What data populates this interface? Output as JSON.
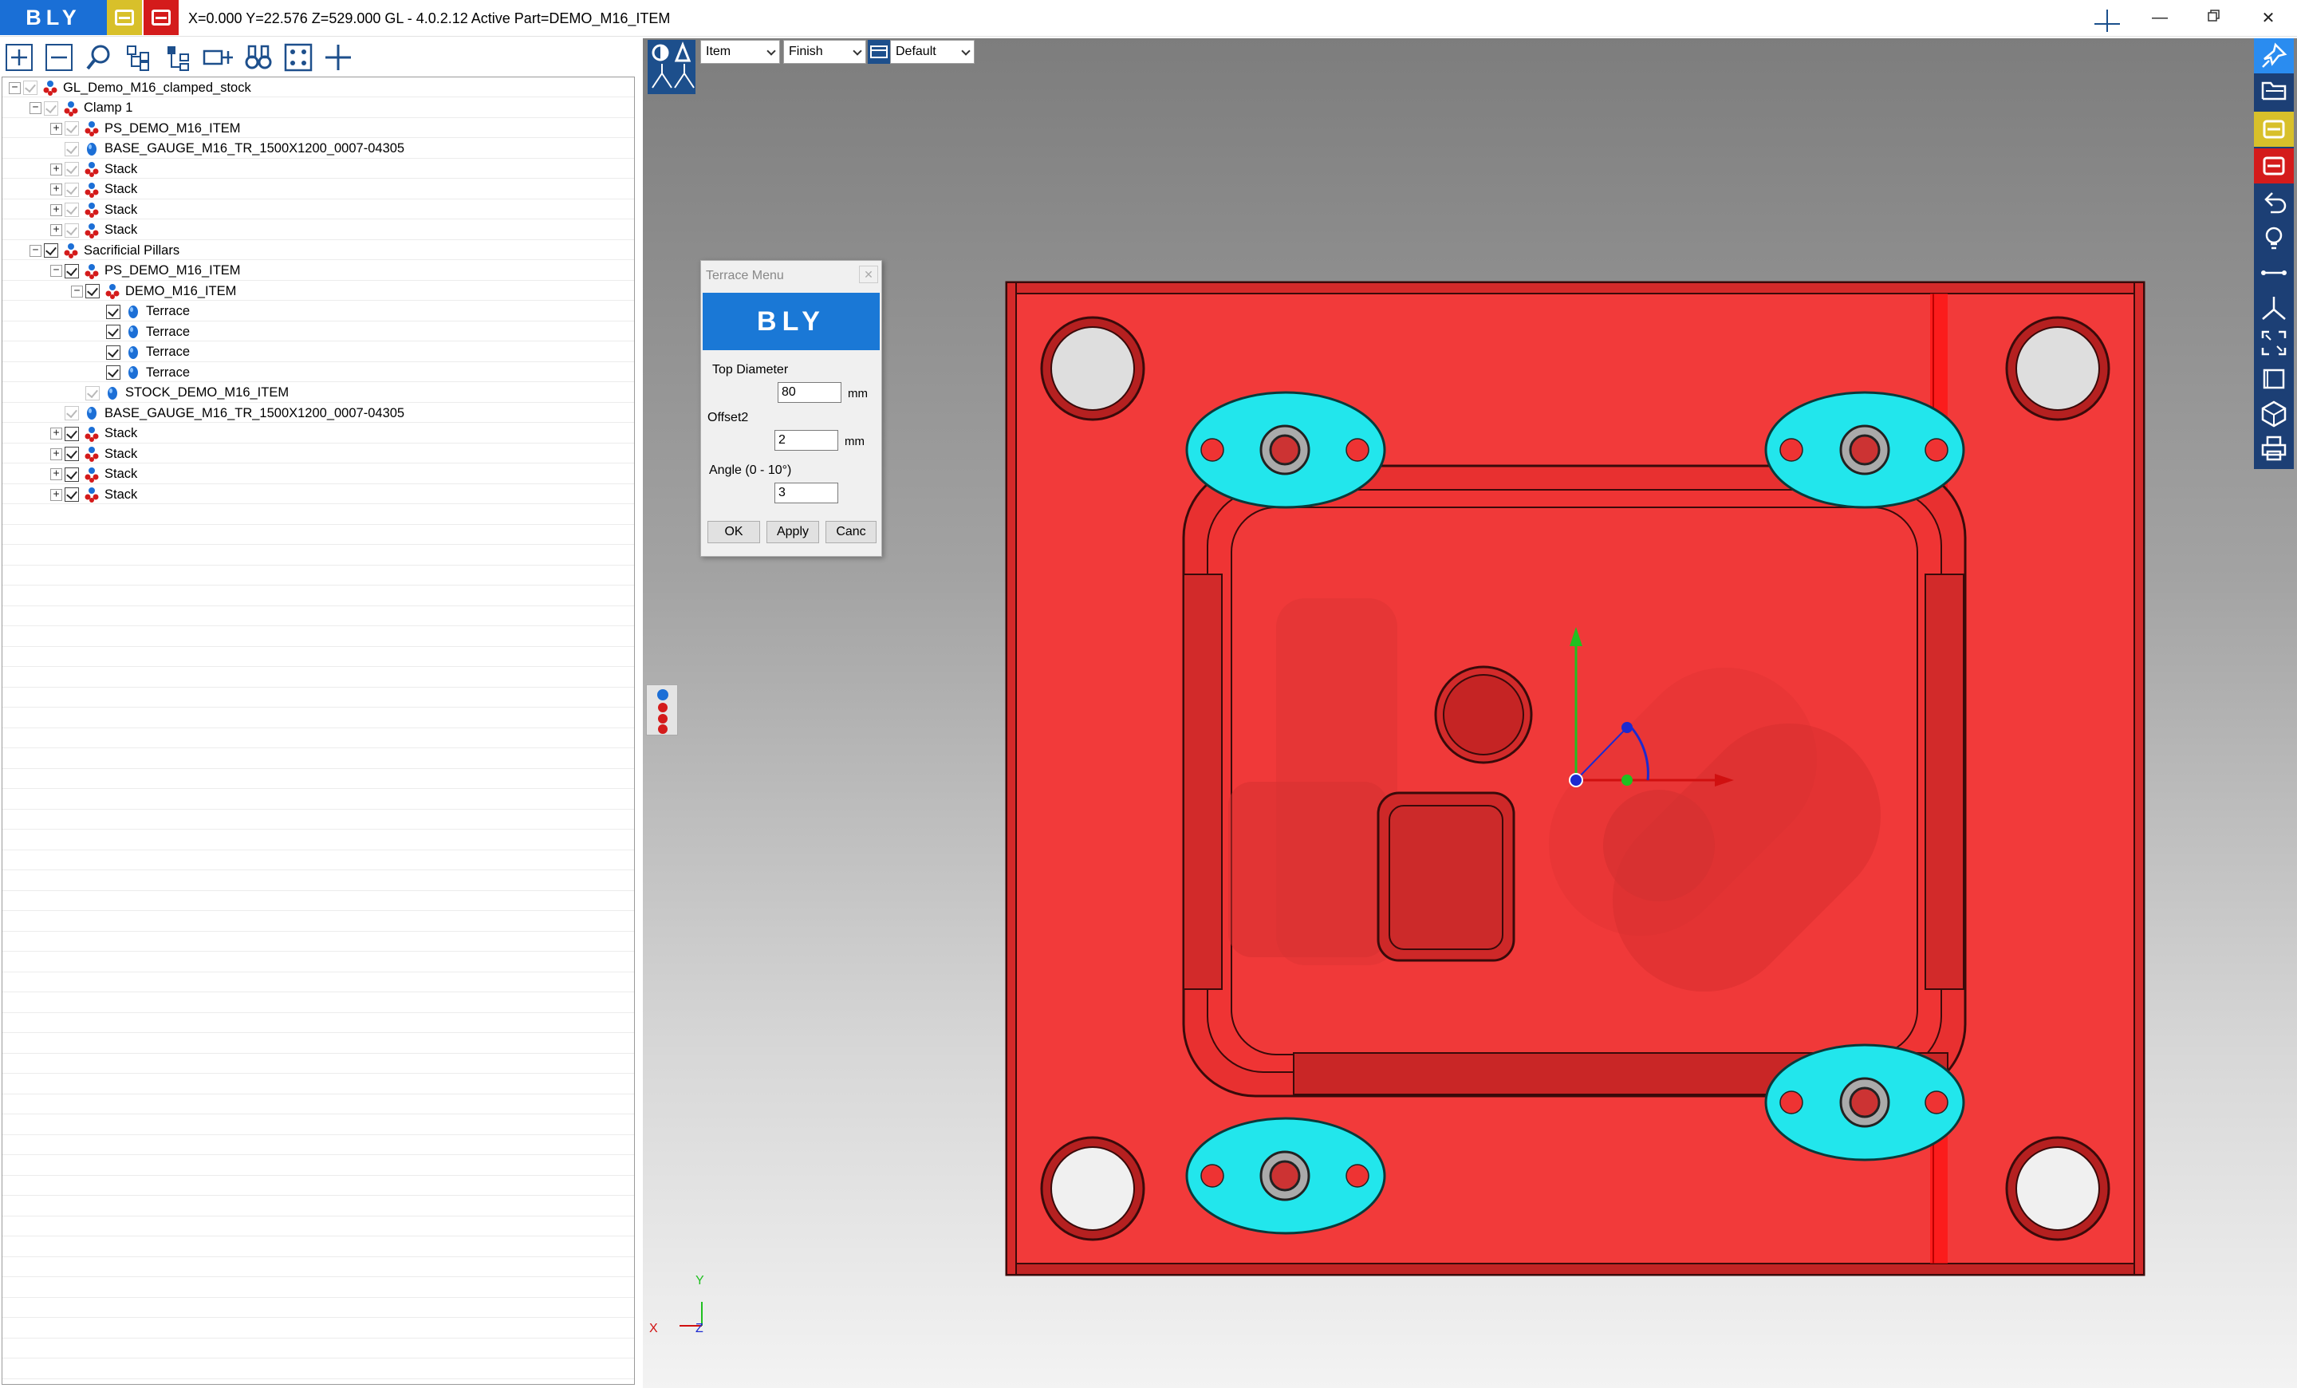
{
  "titlebar": {
    "logo": "BLY",
    "status": "X=0.000 Y=22.576 Z=529.000   GL - 4.0.2.12 Active Part=DEMO_M16_ITEM",
    "controls": [
      "minimize-icon",
      "restore-icon",
      "close-icon"
    ]
  },
  "toolbar": {
    "tools": [
      "add-icon",
      "remove-icon",
      "search-icon",
      "tree-expand-icon",
      "tree-collapse-icon",
      "measure-icon",
      "binoculars-icon",
      "fit-points-icon",
      "crosshair-icon"
    ]
  },
  "tree": {
    "items": [
      {
        "label": "GL_Demo_M16_clamped_stock",
        "icon": "assembly-icon"
      },
      {
        "label": "Clamp 1",
        "icon": "assembly-icon"
      },
      {
        "label": "PS_DEMO_M16_ITEM",
        "icon": "assembly-icon"
      },
      {
        "label": "BASE_GAUGE_M16_TR_1500X1200_0007-04305",
        "icon": "part-icon"
      },
      {
        "label": "Stack",
        "icon": "assembly-icon"
      },
      {
        "label": "Stack",
        "icon": "assembly-icon"
      },
      {
        "label": "Stack",
        "icon": "assembly-icon"
      },
      {
        "label": "Stack",
        "icon": "assembly-icon"
      },
      {
        "label": "Sacrificial Pillars",
        "icon": "assembly-icon"
      },
      {
        "label": "PS_DEMO_M16_ITEM",
        "icon": "assembly-icon"
      },
      {
        "label": "DEMO_M16_ITEM",
        "icon": "assembly-icon"
      },
      {
        "label": "Terrace",
        "icon": "part-icon"
      },
      {
        "label": "Terrace",
        "icon": "part-icon"
      },
      {
        "label": "Terrace",
        "icon": "part-icon"
      },
      {
        "label": "Terrace",
        "icon": "part-icon"
      },
      {
        "label": "STOCK_DEMO_M16_ITEM",
        "icon": "part-icon"
      },
      {
        "label": "BASE_GAUGE_M16_TR_1500X1200_0007-04305",
        "icon": "part-icon"
      },
      {
        "label": "Stack",
        "icon": "assembly-icon"
      },
      {
        "label": "Stack",
        "icon": "assembly-icon"
      },
      {
        "label": "Stack",
        "icon": "assembly-icon"
      },
      {
        "label": "Stack",
        "icon": "assembly-icon"
      }
    ]
  },
  "view_bar": {
    "mode_select": "Item",
    "finish_select": "Finish",
    "view_select": "Default"
  },
  "dialog": {
    "title": "Terrace Menu",
    "banner": "BLY",
    "top_diameter_label": "Top Diameter",
    "top_diameter_value": "80",
    "top_diameter_unit": "mm",
    "offset2_label": "Offset2",
    "offset2_value": "2",
    "offset2_unit": "mm",
    "angle_label": "Angle (0 - 10°)",
    "angle_value": "3",
    "ok_label": "OK",
    "apply_label": "Apply",
    "cancel_label": "Canc"
  },
  "axis": {
    "y_label": "Y",
    "x_label": "X",
    "z_label": "Z"
  },
  "colors": {
    "brand_blue": "#1a6fd6",
    "part_red": "#f03a3a",
    "terrace_cyan": "#22e6ec",
    "sidebar_navy": "#1c3f75"
  }
}
